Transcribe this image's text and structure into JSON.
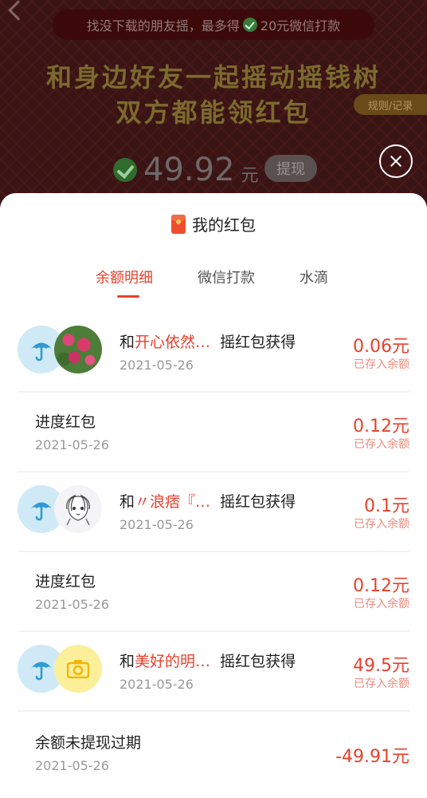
{
  "background": {
    "banner_prefix": "找没下载的朋友摇，最多得",
    "banner_suffix": "20元微信打款",
    "title_line1": "和身边好友一起摇动摇钱树",
    "title_line2": "双方都能领红包",
    "rule_label": "规则/记录",
    "balance_value": "49.92",
    "balance_unit": "元",
    "withdraw_label": "提现"
  },
  "sheet": {
    "title": "我的红包",
    "tabs": [
      {
        "label": "余额明细",
        "active": true
      },
      {
        "label": "微信打款",
        "active": false
      },
      {
        "label": "水滴",
        "active": false
      }
    ],
    "records": [
      {
        "prefix": "和",
        "friend": "开心依然…",
        "suffix": "摇红包获得",
        "date": "2021-05-26",
        "amount": "0.06元",
        "status": "已存入余额",
        "avatar": "flower-photo"
      },
      {
        "label": "进度红包",
        "date": "2021-05-26",
        "amount": "0.12元",
        "status": "已存入余额"
      },
      {
        "prefix": "和",
        "friend": "〃浪痞『…",
        "suffix": "摇红包获得",
        "date": "2021-05-26",
        "amount": "0.1元",
        "status": "已存入余额",
        "avatar": "anime-sketch"
      },
      {
        "label": "进度红包",
        "date": "2021-05-26",
        "amount": "0.12元",
        "status": "已存入余额"
      },
      {
        "prefix": "和",
        "friend": "美好的明…",
        "suffix": "摇红包获得",
        "date": "2021-05-26",
        "amount": "49.5元",
        "status": "已存入余额",
        "avatar": "camera-icon"
      },
      {
        "label": "余额未提现过期",
        "date": "2021-05-26",
        "amount": "-49.91元",
        "status": ""
      }
    ]
  },
  "colors": {
    "accent": "#e8412c",
    "status": "#f08a7c",
    "muted": "#999999",
    "umbrella_bg": "#cfeaf6",
    "umbrella": "#2f9bd6"
  }
}
